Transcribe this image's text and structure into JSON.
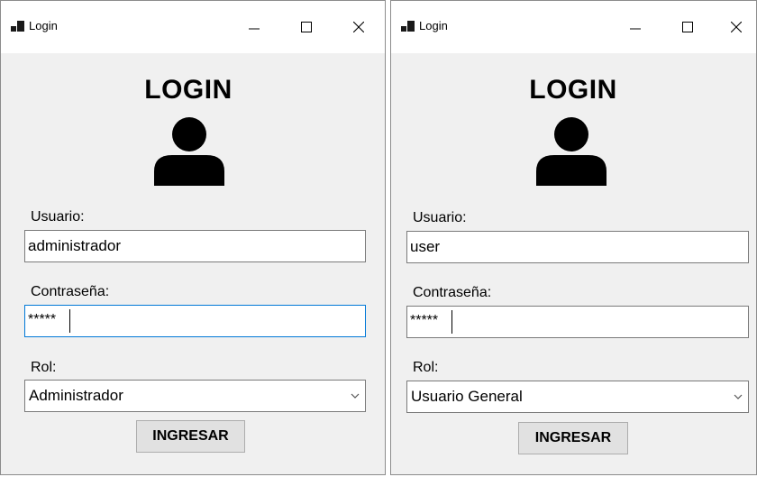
{
  "windows": [
    {
      "title": "Login",
      "heading": "LOGIN",
      "username_label": "Usuario:",
      "username_value": "administrador",
      "password_label": "Contraseña:",
      "password_value": "*****",
      "role_label": "Rol:",
      "role_value": "Administrador",
      "submit_label": "INGRESAR",
      "focused_field": "password"
    },
    {
      "title": "Login",
      "heading": "LOGIN",
      "username_label": "Usuario:",
      "username_value": "user",
      "password_label": "Contraseña:",
      "password_value": "*****",
      "role_label": "Rol:",
      "role_value": "Usuario General",
      "submit_label": "INGRESAR",
      "focused_field": "password"
    }
  ],
  "icons": {
    "app": "app-icon",
    "minimize": "minimize-icon",
    "maximize": "maximize-icon",
    "close": "close-icon",
    "user": "user-icon",
    "dropdown": "chevron-down-icon"
  },
  "colors": {
    "window_bg": "#f0f0f0",
    "focus_border": "#0078d7",
    "button_bg": "#e1e1e1"
  }
}
